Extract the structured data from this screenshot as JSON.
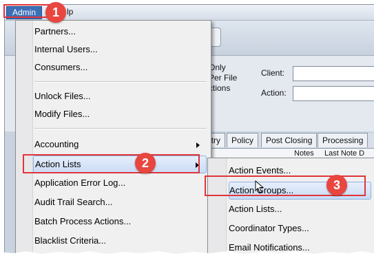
{
  "menubar": {
    "admin_label": "Admin",
    "help_label": "lp"
  },
  "filters": {
    "only_label": "Only",
    "per_file_label": "Per File",
    "actions_label": "ctions",
    "client_label": "Client:",
    "action_label": "Action:",
    "client_value": "",
    "action_value": ""
  },
  "tabs": [
    "ntry",
    "Policy",
    "Post Closing",
    "Processing"
  ],
  "grid_headers": [
    "Notes",
    "Last Note D"
  ],
  "admin_menu": {
    "group1": [
      "Partners...",
      "Internal Users...",
      "Consumers..."
    ],
    "group2": [
      "Unlock Files...",
      "Modify Files..."
    ],
    "group3": [
      {
        "label": "Accounting",
        "submenu": true
      },
      {
        "label": "Action Lists",
        "submenu": true,
        "highlighted": true
      },
      {
        "label": "Application Error Log...",
        "submenu": false
      },
      {
        "label": "Audit Trail Search...",
        "submenu": false
      },
      {
        "label": "Batch Process Actions...",
        "submenu": false
      },
      {
        "label": "Blacklist Criteria...",
        "submenu": false
      }
    ]
  },
  "action_lists_submenu": [
    {
      "label": "Action Events...",
      "highlighted": false
    },
    {
      "label": "Action Groups...",
      "highlighted": true
    },
    {
      "label": "Action Lists...",
      "highlighted": false
    },
    {
      "label": "Coordinator Types...",
      "highlighted": false
    },
    {
      "label": "Email Notifications...",
      "highlighted": false
    }
  ],
  "annotations": {
    "step1": "1",
    "step2": "2",
    "step3": "3",
    "color": "#e0343a"
  }
}
